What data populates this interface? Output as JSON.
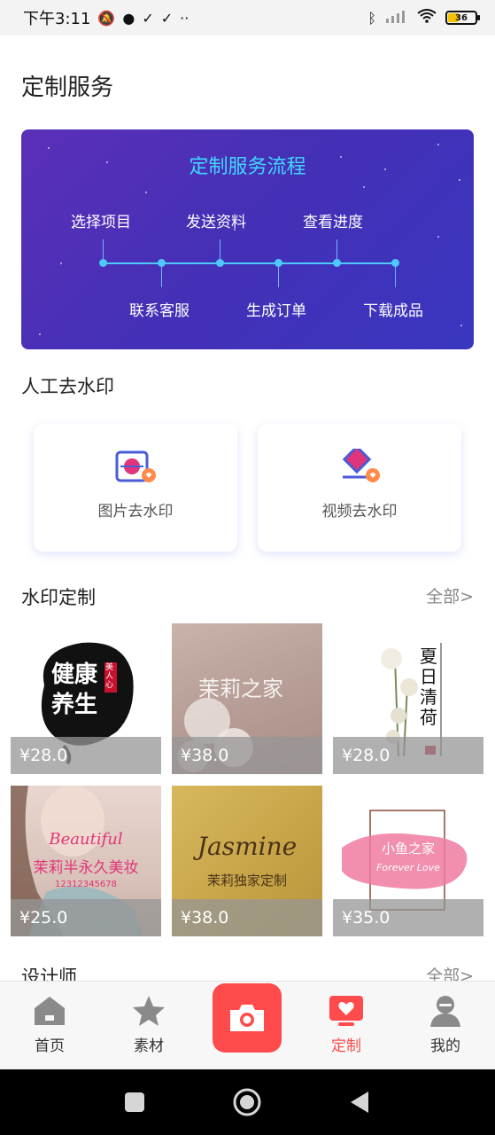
{
  "status_bar": {
    "time": "下午3:11",
    "battery": "36",
    "icons": [
      "mute-bell-icon",
      "message-icon",
      "check-icon",
      "check-icon",
      "more-dots-icon",
      "bluetooth-icon",
      "signal-icon",
      "wifi-icon",
      "battery-icon"
    ]
  },
  "page_title": "定制服务",
  "banner": {
    "title": "定制服务流程",
    "steps_top": [
      "选择项目",
      "发送资料",
      "查看进度"
    ],
    "steps_bottom": [
      "联系客服",
      "生成订单",
      "下载成品"
    ],
    "accent": "#3fd8ff"
  },
  "watermark_section": {
    "title": "人工去水印",
    "cards": [
      {
        "label": "图片去水印",
        "icon": "image-watermark-icon"
      },
      {
        "label": "视频去水印",
        "icon": "video-watermark-icon"
      }
    ]
  },
  "custom_section": {
    "title": "水印定制",
    "more": "全部>",
    "products": [
      {
        "price": "¥28.0",
        "text_main": "健康养生",
        "text_seal": "美人心"
      },
      {
        "price": "¥38.0",
        "text_main": "茉莉之家"
      },
      {
        "price": "¥28.0",
        "text_main": "夏日清荷"
      },
      {
        "price": "¥25.0",
        "text_main": "Beautiful",
        "text_sub": "茉莉半永久美妆",
        "text_phone": "12312345678"
      },
      {
        "price": "¥38.0",
        "text_main": "Jasmine",
        "text_sub": "茉莉独家定制"
      },
      {
        "price": "¥35.0",
        "text_main": "小鱼之家",
        "text_sub": "Forever Love"
      }
    ]
  },
  "designer_section": {
    "title": "设计师",
    "more": "全部>"
  },
  "bottom_nav": {
    "items": [
      {
        "label": "首页",
        "icon": "home-icon"
      },
      {
        "label": "素材",
        "icon": "star-icon"
      },
      {
        "label": "定制",
        "icon": "custom-tv-heart-icon",
        "active": true
      },
      {
        "label": "我的",
        "icon": "profile-icon"
      }
    ],
    "center_icon": "camera-icon",
    "active_color": "#ff4b4b"
  },
  "system_nav": [
    "recent-apps-icon",
    "home-circle-icon",
    "back-icon"
  ]
}
